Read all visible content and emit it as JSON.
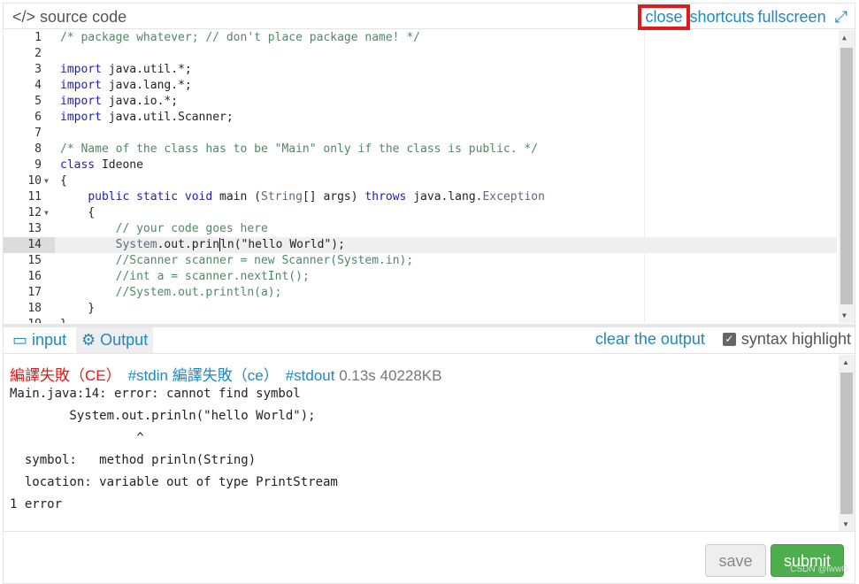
{
  "header": {
    "icon": "code-icon",
    "title": "source code",
    "links": [
      "close",
      "shortcuts",
      "fullscreen"
    ],
    "fullscreen_icon": "expand-icon"
  },
  "editor": {
    "active_line": 14,
    "folds": [
      10,
      12
    ],
    "lines": [
      [
        [
          "c",
          "/* package whatever; // don't place package name! */"
        ]
      ],
      [],
      [
        [
          "k",
          "import"
        ],
        [
          "",
          "java.util.*;"
        ]
      ],
      [
        [
          "k",
          "import"
        ],
        [
          "",
          "java.lang.*;"
        ]
      ],
      [
        [
          "k",
          "import"
        ],
        [
          "",
          "java.io.*;"
        ]
      ],
      [
        [
          "k",
          "import"
        ],
        [
          "",
          "java.util.Scanner;"
        ]
      ],
      [],
      [
        [
          "c",
          "/* Name of the class has to be \"Main\" only if the class is public. */"
        ]
      ],
      [
        [
          "k",
          "class"
        ],
        [
          "",
          " Ideone"
        ]
      ],
      [
        [
          "",
          "{"
        ]
      ],
      [
        [
          "",
          "    "
        ],
        [
          "k",
          "public static void"
        ],
        [
          "",
          " main ("
        ],
        [
          "t",
          "String"
        ],
        [
          "",
          "[] args) "
        ],
        [
          "k",
          "throws"
        ],
        [
          "",
          " java.lang."
        ],
        [
          "t",
          "Exception"
        ]
      ],
      [
        [
          "",
          "    {"
        ]
      ],
      [
        [
          "",
          "        "
        ],
        [
          "c",
          "// your code goes here"
        ]
      ],
      [
        [
          "",
          "        "
        ],
        [
          "t",
          "System"
        ],
        [
          "",
          ".out.prin"
        ],
        [
          "cur",
          ""
        ],
        [
          "",
          "ln(\"hello World\");"
        ]
      ],
      [
        [
          "",
          "        "
        ],
        [
          "c",
          "//Scanner scanner = new Scanner(System.in);"
        ]
      ],
      [
        [
          "",
          "        "
        ],
        [
          "c",
          "//int a = scanner.nextInt();"
        ]
      ],
      [
        [
          "",
          "        "
        ],
        [
          "c",
          "//System.out.println(a);"
        ]
      ],
      [
        [
          "",
          "    }"
        ]
      ],
      [
        [
          "",
          "}"
        ]
      ]
    ]
  },
  "output_toolbar": {
    "tabs": [
      {
        "label": "input",
        "icon": "inbox-icon"
      },
      {
        "label": "Output",
        "icon": "gears-icon",
        "active": true
      }
    ],
    "clear_label": "clear the output",
    "syntax_label": "syntax highlight",
    "syntax_checked": true
  },
  "output": {
    "status": "編譯失敗（CE）",
    "stdin_label": "#stdin",
    "stdin_status": "編譯失敗（ce）",
    "stdout_label": "#stdout",
    "time": "0.13s",
    "memory": "40228KB",
    "lines": [
      "Main.java:14: error: cannot find symbol",
      "        System.out.prinln(\"hello World\");",
      "                 ^",
      "  symbol:   method prinln(String)",
      "  location: variable out of type PrintStream",
      "1 error"
    ]
  },
  "buttons": {
    "save": "save",
    "submit": "submit"
  },
  "watermark": "CSDN @lwwG",
  "colors": {
    "link": "#1e88c7",
    "error": "#e01b1b",
    "submit": "#4cae4c",
    "highlight_box": "#e01b1b"
  }
}
